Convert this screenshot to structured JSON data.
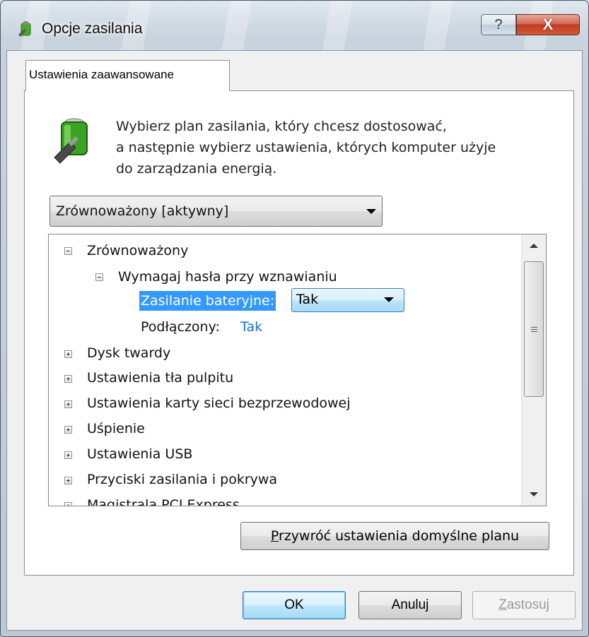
{
  "window": {
    "title": "Opcje zasilania",
    "help_label": "?",
    "close_label": "X"
  },
  "tab": {
    "label": "Ustawienia zaawansowane"
  },
  "description": {
    "line1": "Wybierz plan zasilania, który chcesz dostosować,",
    "line2": "a następnie wybierz ustawienia, których komputer użyje",
    "line3": "do zarządzania energią."
  },
  "plan_select": {
    "value": "Zrównoważony [aktywny]"
  },
  "tree": {
    "root": "Zrównoważony",
    "group": "Wymagaj hasła przy wznawianiu",
    "battery_label": "Zasilanie bateryjne:",
    "battery_value": "Tak",
    "plugged_label": "Podłączony:",
    "plugged_value": "Tak",
    "items": [
      "Dysk twardy",
      "Ustawienia tła pulpitu",
      "Ustawienia karty sieci bezprzewodowej",
      "Uśpienie",
      "Ustawienia USB",
      "Przyciski zasilania i pokrywa",
      "Magistrala PCI Express"
    ]
  },
  "restore_button": {
    "accel": "P",
    "rest": "rzywróć ustawienia domyślne planu"
  },
  "buttons": {
    "ok": "OK",
    "cancel": "Anuluj",
    "apply_accel": "Z",
    "apply_rest": "astosuj"
  },
  "colors": {
    "selection": "#3399ff",
    "link_value": "#1c6fbf",
    "close_button": "#c23b22"
  }
}
